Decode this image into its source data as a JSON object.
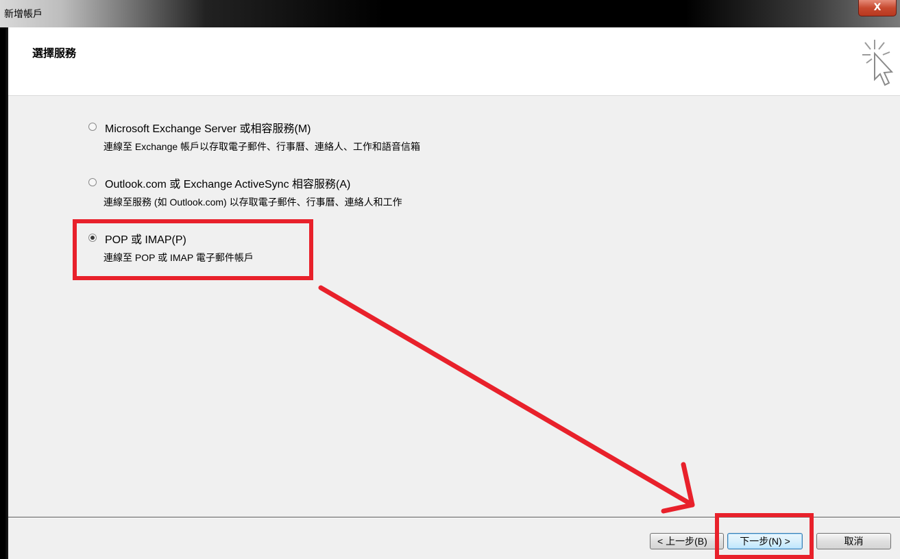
{
  "window": {
    "title": "新增帳戶",
    "close_glyph": "X"
  },
  "header": {
    "title": "選擇服務",
    "icon": "wizard-cursor-icon"
  },
  "options": [
    {
      "label": "Microsoft Exchange Server 或相容服務(M)",
      "description": "連線至 Exchange 帳戶以存取電子郵件、行事曆、連絡人、工作和語音信箱",
      "checked": false
    },
    {
      "label": "Outlook.com 或 Exchange ActiveSync 相容服務(A)",
      "description": "連線至服務 (如 Outlook.com) 以存取電子郵件、行事曆、連絡人和工作",
      "checked": false
    },
    {
      "label": "POP 或 IMAP(P)",
      "description": "連線至 POP 或 IMAP 電子郵件帳戶",
      "checked": true
    }
  ],
  "buttons": {
    "back": "< 上一步(B)",
    "next": "下一步(N) >",
    "cancel": "取消"
  },
  "annotation_color": "#e8212b"
}
